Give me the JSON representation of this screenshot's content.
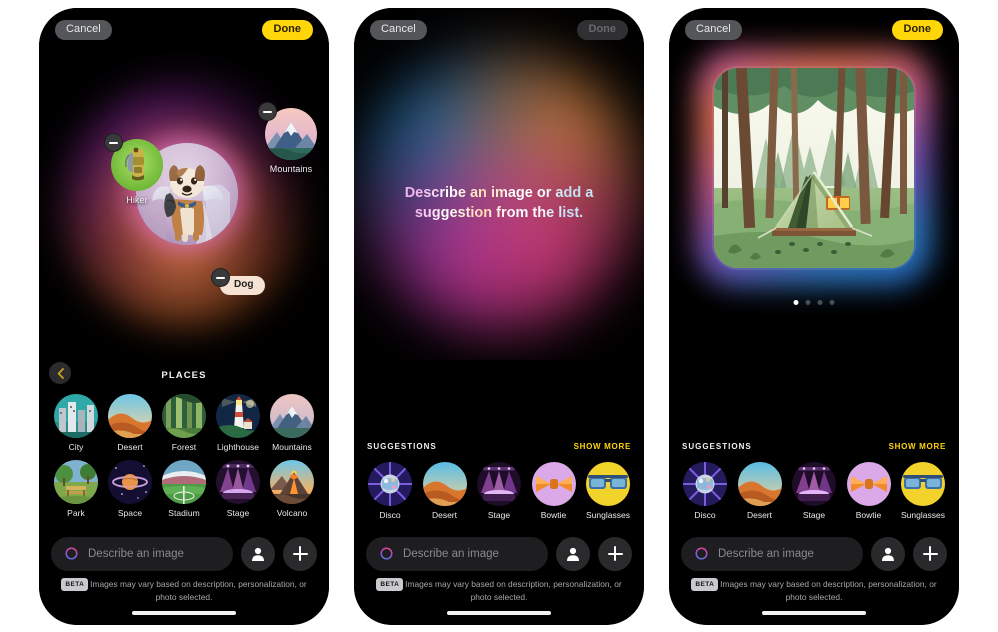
{
  "nav": {
    "cancel_label": "Cancel",
    "done_label": "Done"
  },
  "screen1": {
    "canvas": {
      "concepts": [
        {
          "label": "Hiker",
          "remove_icon": "minus-icon"
        },
        {
          "label": "Mountains",
          "remove_icon": "minus-icon"
        },
        {
          "label": "Dog",
          "remove_icon": "minus-icon"
        }
      ]
    },
    "places": {
      "title": "PLACES",
      "back_icon": "chevron-left-icon",
      "items": [
        {
          "label": "City"
        },
        {
          "label": "Desert"
        },
        {
          "label": "Forest"
        },
        {
          "label": "Lighthouse"
        },
        {
          "label": "Mountains"
        },
        {
          "label": "Park"
        },
        {
          "label": "Space"
        },
        {
          "label": "Stadium"
        },
        {
          "label": "Stage"
        },
        {
          "label": "Volcano"
        }
      ]
    }
  },
  "screen2": {
    "prompt_text": "Describe an image or add a suggestion from the list.",
    "done_disabled": true
  },
  "screen3": {
    "generated_image_alt": "tent in forest",
    "page_dots": {
      "count": 4,
      "active_index": 0
    }
  },
  "suggestions": {
    "title": "SUGGESTIONS",
    "show_more_label": "SHOW MORE",
    "items": [
      {
        "label": "Disco"
      },
      {
        "label": "Desert"
      },
      {
        "label": "Stage"
      },
      {
        "label": "Bowtie"
      },
      {
        "label": "Sunglasses"
      }
    ]
  },
  "composer": {
    "ai_icon": "image-playground-icon",
    "placeholder": "Describe an image",
    "person_icon": "person-icon",
    "add_icon": "plus-icon",
    "beta_badge": "BETA",
    "disclaimer": "Images may vary based on description, personalization, or photo selected."
  },
  "colors": {
    "accent_yellow": "#ffd60a",
    "cancel_gray": "#55565a",
    "chip_cream": "#f7e3d4"
  }
}
